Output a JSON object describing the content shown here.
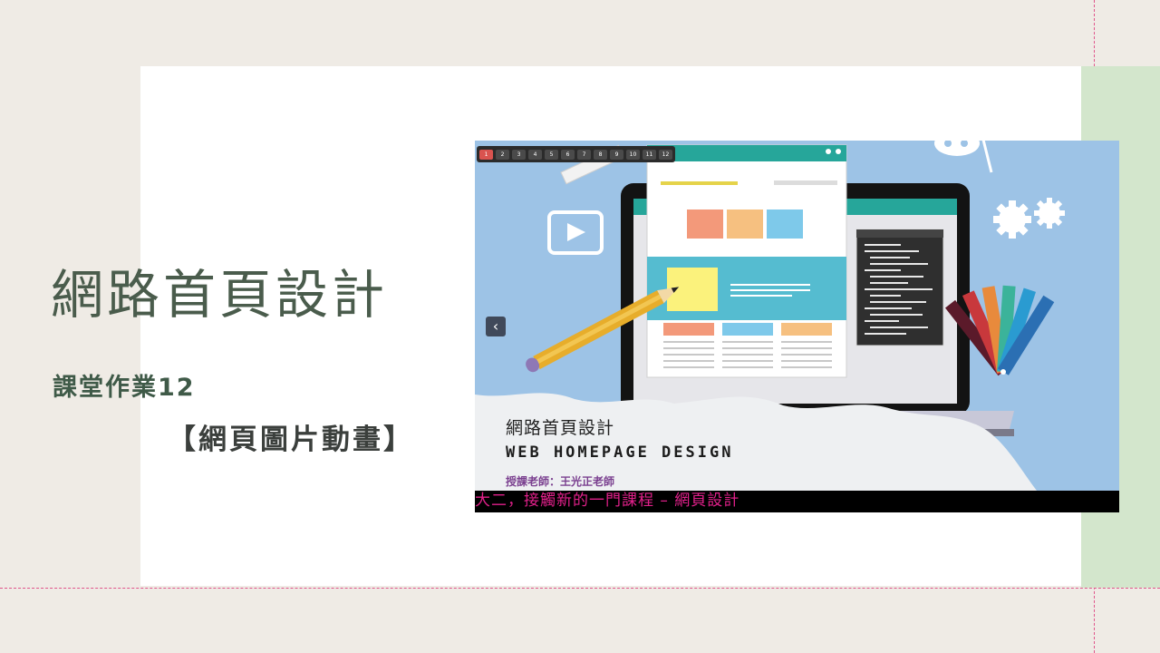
{
  "slide": {
    "title": "網路首頁設計",
    "subtitle": "課堂作業12",
    "bracket_title": "【網頁圖片動畫】"
  },
  "thumbnail": {
    "pager": [
      "1",
      "2",
      "3",
      "4",
      "5",
      "6",
      "7",
      "8",
      "9",
      "10",
      "11",
      "12"
    ],
    "active_page": "1",
    "prev_icon": "‹",
    "course_title": "網路首頁設計",
    "course_title_en": "WEB HOMEPAGE DESIGN",
    "teacher": "授課老師：王光正老師",
    "caption": "大二，接觸新的一門課程 – 網頁設計"
  },
  "colors": {
    "background": "#efebe5",
    "card": "#ffffff",
    "green_band": "#d3e6cc",
    "guide": "#e0548a",
    "title_text": "#4a5c4c",
    "caption_text": "#e0208a",
    "slide_bg": "#9dc3e6"
  }
}
